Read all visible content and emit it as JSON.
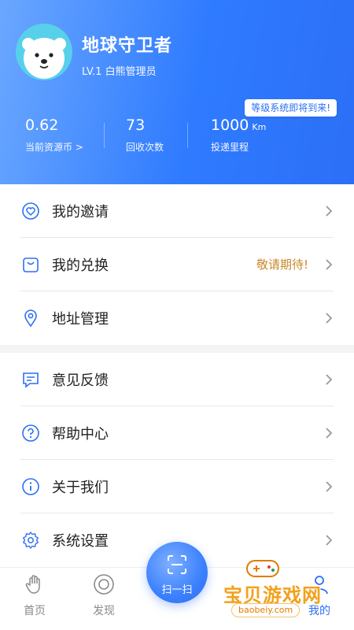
{
  "profile": {
    "name": "地球守卫者",
    "level": "LV.1 白熊管理员",
    "avatar_icon": "polar-bear-icon",
    "level_tip": "等级系统即将到来!"
  },
  "stats": [
    {
      "value": "0.62",
      "unit": "",
      "label": "当前资源币 >"
    },
    {
      "value": "73",
      "unit": "",
      "label": "回收次数"
    },
    {
      "value": "1000",
      "unit": "Km",
      "label": "投递里程"
    }
  ],
  "menu": {
    "section1": [
      {
        "icon": "heart-icon",
        "label": "我的邀请",
        "extra": ""
      },
      {
        "icon": "shopping-bag-icon",
        "label": "我的兑换",
        "extra": "敬请期待!"
      },
      {
        "icon": "location-pin-icon",
        "label": "地址管理",
        "extra": ""
      }
    ],
    "section2": [
      {
        "icon": "feedback-icon",
        "label": "意见反馈"
      },
      {
        "icon": "help-icon",
        "label": "帮助中心"
      },
      {
        "icon": "info-icon",
        "label": "关于我们"
      },
      {
        "icon": "gear-icon",
        "label": "系统设置"
      }
    ]
  },
  "tabbar": {
    "home": "首页",
    "discover": "发现",
    "scan": "扫一扫",
    "mine": "我的"
  },
  "watermark": {
    "text": "宝贝游戏网",
    "url": "baobeiy.com"
  },
  "colors": {
    "primary": "#2b6ff6",
    "header_start": "#6aa7ff",
    "accent_text": "#c8892a"
  }
}
